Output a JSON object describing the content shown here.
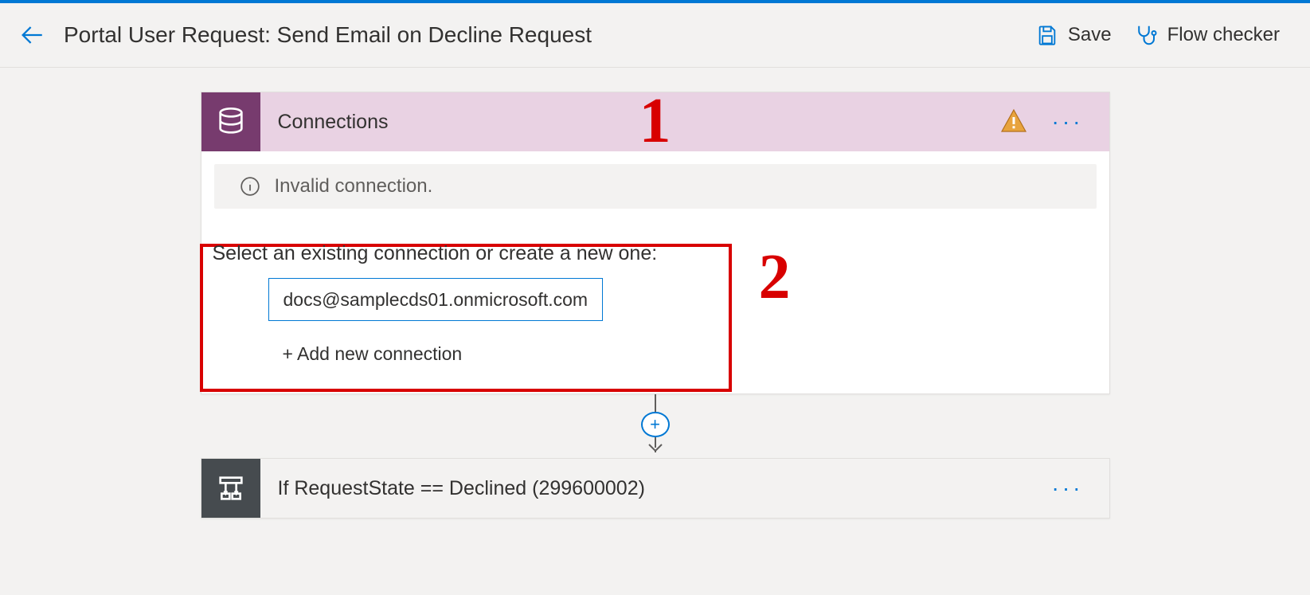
{
  "header": {
    "title": "Portal User Request: Send Email on Decline Request",
    "actions": {
      "save": "Save",
      "flow_checker": "Flow checker"
    }
  },
  "markers": {
    "one": "1",
    "two": "2"
  },
  "connections_card": {
    "title": "Connections",
    "info": "Invalid connection.",
    "select_label": "Select an existing connection or create a new one:",
    "existing_connection": "docs@samplecds01.onmicrosoft.com",
    "add_new": "+ Add new connection"
  },
  "condition_card": {
    "title": "If RequestState == Declined (299600002)"
  },
  "icons": {
    "more": "···",
    "plus": "+"
  }
}
